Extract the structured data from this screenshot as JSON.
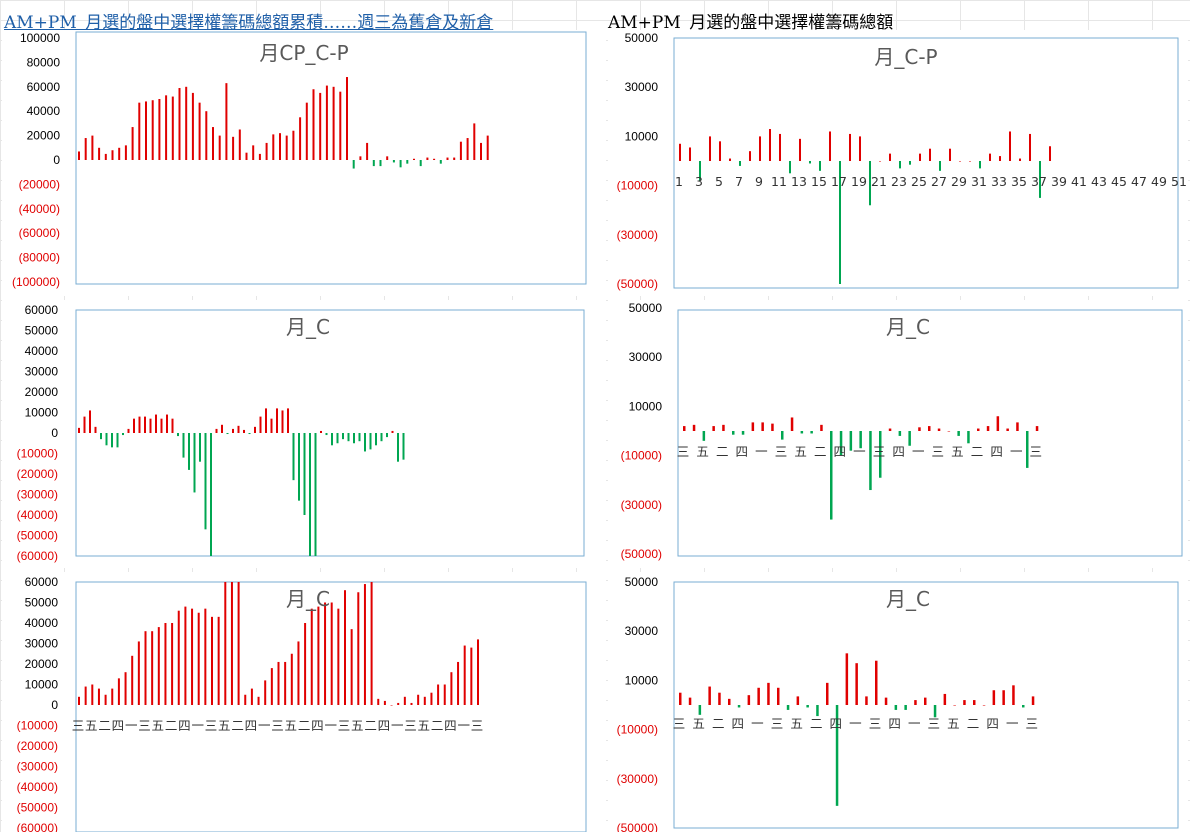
{
  "header": {
    "left_title": "AM+PM_月選的盤中選擇權籌碼總額累積……週三為舊倉及新倉",
    "right_title": "AM+PM_月選的盤中選擇權籌碼總額"
  },
  "colors": {
    "positive": "#e00000",
    "negative": "#00a651",
    "axis_positive_text": "#000000",
    "axis_negative_text": "#e00000",
    "plot_border": "#7aaed3"
  },
  "chart_data": [
    {
      "id": "c1",
      "type": "bar",
      "title": "月CP_C-P",
      "ylim": [
        -100000,
        100000
      ],
      "yticks": [
        100000,
        80000,
        60000,
        40000,
        20000,
        0,
        -20000,
        -40000,
        -60000,
        -80000,
        -100000
      ],
      "ytick_labels": [
        "100000",
        "80000",
        "60000",
        "40000",
        "20000",
        "0",
        "(20000)",
        "(40000)",
        "(60000)",
        "(80000)",
        "(100000)"
      ],
      "categories": [],
      "values": [
        7000,
        18000,
        20000,
        10000,
        5000,
        8000,
        10000,
        12000,
        27000,
        47000,
        48000,
        49000,
        50000,
        53000,
        52000,
        59000,
        60000,
        55000,
        47000,
        40000,
        27000,
        20000,
        63000,
        19000,
        25000,
        6000,
        12000,
        5000,
        14000,
        21000,
        22000,
        20000,
        24000,
        35000,
        47000,
        58000,
        55000,
        61000,
        60000,
        56000,
        68000,
        -7000,
        3000,
        14000,
        -5000,
        -5000,
        3000,
        -2000,
        -6000,
        -3000,
        1000,
        -5000,
        2000,
        1000,
        -3000,
        2000,
        2000,
        15000,
        18000,
        30000,
        14000,
        20000
      ]
    },
    {
      "id": "c2",
      "type": "bar",
      "title": "月_C-P",
      "ylim": [
        -50000,
        50000
      ],
      "yticks": [
        50000,
        30000,
        10000,
        -10000,
        -30000,
        -50000
      ],
      "ytick_labels": [
        "50000",
        "30000",
        "10000",
        "(10000)",
        "(30000)",
        "(50000)"
      ],
      "categories": [
        "1",
        "",
        "3",
        "",
        "5",
        "",
        "7",
        "",
        "9",
        "",
        "11",
        "",
        "13",
        "",
        "15",
        "",
        "17",
        "",
        "19",
        "",
        "21",
        "",
        "23",
        "",
        "25",
        "",
        "27",
        "",
        "29",
        "",
        "31",
        "",
        "33",
        "",
        "35",
        "",
        "37",
        "",
        "39",
        "",
        "41",
        "",
        "43",
        "",
        "45",
        "",
        "47",
        "",
        "49",
        "",
        "51"
      ],
      "values": [
        7000,
        5500,
        -8000,
        10000,
        8000,
        1000,
        -2000,
        4000,
        10000,
        13000,
        11000,
        -5000,
        9000,
        -1000,
        -4000,
        12000,
        -50000,
        11000,
        10000,
        -18000,
        0,
        3000,
        -3000,
        -1500,
        3000,
        5000,
        -4000,
        5000,
        0,
        0,
        -3000,
        3000,
        2000,
        12000,
        1000,
        11000,
        -15000,
        6000
      ]
    },
    {
      "id": "c3",
      "type": "bar",
      "title": "月_C",
      "ylim": [
        -60000,
        60000
      ],
      "yticks": [
        60000,
        50000,
        40000,
        30000,
        20000,
        10000,
        0,
        -10000,
        -20000,
        -30000,
        -40000,
        -50000,
        -60000
      ],
      "ytick_labels": [
        "60000",
        "50000",
        "40000",
        "30000",
        "20000",
        "10000",
        "0",
        "(10000)",
        "(20000)",
        "(30000)",
        "(40000)",
        "(50000)",
        "(60000)"
      ],
      "categories": [],
      "values": [
        2500,
        8000,
        11000,
        3000,
        -3000,
        -6000,
        -7000,
        -7000,
        -1000,
        2000,
        7000,
        8000,
        8000,
        7000,
        9000,
        7000,
        9000,
        7000,
        -1500,
        -12000,
        -18000,
        -29000,
        -14000,
        -47000,
        -60000,
        2000,
        4000,
        -500,
        2000,
        3500,
        1500,
        -500,
        3000,
        8000,
        12000,
        7000,
        12000,
        11000,
        12000,
        -23000,
        -33000,
        -40000,
        -60000,
        -60000,
        1000,
        -1000,
        -6000,
        -5000,
        -3000,
        -4000,
        -5000,
        -4000,
        -9000,
        -8000,
        -6000,
        -4000,
        -2000,
        1000,
        -14000,
        -13000
      ]
    },
    {
      "id": "c4",
      "type": "bar",
      "title": "月_C",
      "ylim": [
        -50000,
        50000
      ],
      "yticks": [
        50000,
        30000,
        10000,
        -10000,
        -30000,
        -50000
      ],
      "ytick_labels": [
        "50000",
        "30000",
        "10000",
        "(10000)",
        "(30000)",
        "(50000)"
      ],
      "categories": [
        "三",
        "",
        "五",
        "",
        "二",
        "",
        "四",
        "",
        "一",
        "",
        "三",
        "",
        "五",
        "",
        "二",
        "",
        "四",
        "",
        "一",
        "",
        "三",
        "",
        "四",
        "",
        "一",
        "",
        "三",
        "",
        "五",
        "",
        "二",
        "",
        "四",
        "",
        "一",
        "",
        "三"
      ],
      "values": [
        2000,
        2500,
        -4000,
        2000,
        2500,
        -1500,
        -1500,
        3500,
        3500,
        3000,
        -3500,
        5500,
        -1000,
        -1000,
        2500,
        -36000,
        -10000,
        -8000,
        -7000,
        -24000,
        -19000,
        1000,
        -2000,
        -6000,
        1500,
        2000,
        1000,
        0,
        -2000,
        -5000,
        1000,
        2000,
        6000,
        1000,
        3500,
        -15000,
        2000
      ]
    },
    {
      "id": "c5",
      "type": "bar",
      "title": "月_C",
      "ylim": [
        -60000,
        60000
      ],
      "yticks": [
        60000,
        50000,
        40000,
        30000,
        20000,
        10000,
        0,
        -10000,
        -20000,
        -30000,
        -40000,
        -50000,
        -60000
      ],
      "ytick_labels": [
        "60000",
        "50000",
        "40000",
        "30000",
        "20000",
        "10000",
        "0",
        "(10000)",
        "(20000)",
        "(30000)",
        "(40000)",
        "(50000)",
        "(60000)"
      ],
      "categories": [
        "三",
        "五",
        "二",
        "四",
        "一",
        "三",
        "五",
        "二",
        "四",
        "一",
        "三",
        "五",
        "二",
        "四",
        "一",
        "三",
        "五",
        "二",
        "四",
        "一",
        "三",
        "五",
        "二",
        "四",
        "一",
        "三",
        "五",
        "二",
        "四",
        "一",
        "三"
      ],
      "values": [
        4000,
        9000,
        10000,
        8000,
        5000,
        8000,
        13000,
        16000,
        24000,
        31000,
        36000,
        36000,
        38000,
        40000,
        40000,
        46000,
        48000,
        47000,
        45000,
        47000,
        43000,
        43000,
        60000,
        60000,
        60000,
        5000,
        8000,
        4000,
        12000,
        18000,
        21000,
        21000,
        25000,
        31000,
        40000,
        47000,
        48000,
        50000,
        50000,
        47000,
        56000,
        37000,
        55000,
        59000,
        60000,
        3000,
        2000,
        0,
        1000,
        4000,
        1000,
        5000,
        4000,
        6000,
        10000,
        10000,
        16000,
        21000,
        29000,
        28000,
        32000
      ]
    },
    {
      "id": "c6",
      "type": "bar",
      "title": "月_C",
      "ylim": [
        -50000,
        50000
      ],
      "yticks": [
        50000,
        30000,
        10000,
        -10000,
        -30000,
        -50000
      ],
      "ytick_labels": [
        "50000",
        "30000",
        "10000",
        "(10000)",
        "(30000)",
        "(50000)"
      ],
      "categories": [
        "三",
        "",
        "五",
        "",
        "二",
        "",
        "四",
        "",
        "一",
        "",
        "三",
        "",
        "五",
        "",
        "二",
        "",
        "四",
        "",
        "一",
        "",
        "三",
        "",
        "四",
        "",
        "一",
        "",
        "三",
        "",
        "五",
        "",
        "二",
        "",
        "四",
        "",
        "一",
        "",
        "三"
      ],
      "values": [
        5000,
        3000,
        -4000,
        7500,
        5000,
        2500,
        -1000,
        4000,
        7000,
        9000,
        7000,
        -2000,
        3500,
        -1000,
        -4500,
        9000,
        -41000,
        21000,
        17000,
        3500,
        18000,
        3000,
        -2000,
        -2000,
        2000,
        3000,
        -5000,
        4500,
        0,
        2000,
        2000,
        0,
        6000,
        6000,
        8000,
        -1000,
        3500
      ]
    }
  ]
}
